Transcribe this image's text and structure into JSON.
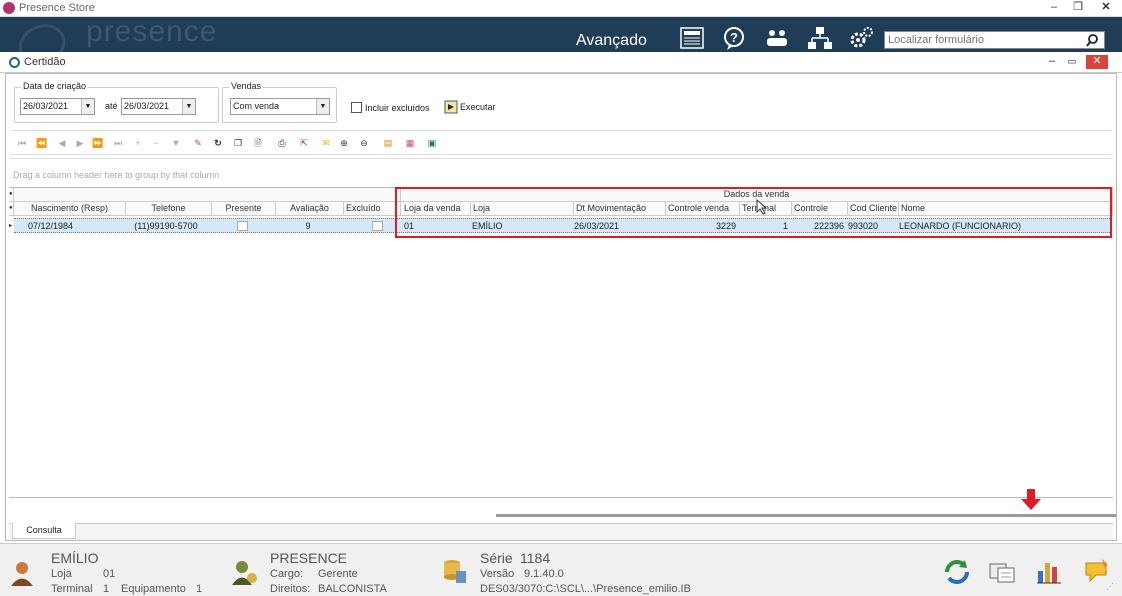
{
  "app": {
    "title": "Presence Store",
    "brand": "presence"
  },
  "banner": {
    "mode_label": "Avançado",
    "search_placeholder": "Localizar formulário"
  },
  "window": {
    "title": "Certidão"
  },
  "filters": {
    "date_group_label": "Data de criação",
    "date_from": "26/03/2021",
    "date_sep": "até",
    "date_to": "26/03/2021",
    "vendas_label": "Vendas",
    "vendas_value": "Com venda",
    "include_deleted_label": "Incluir excluídos",
    "execute_label": "Executar"
  },
  "grid": {
    "group_hint": "Drag a column header here to group by that column",
    "band_label": "Dados da venda",
    "columns": [
      "Nascimento (Resp)",
      "Telefone",
      "Presente",
      "Avaliação",
      "Excluído",
      "Loja da venda",
      "Loja",
      "Dt Movimentação",
      "Controle venda",
      "Terminal",
      "Controle item",
      "Cod Cliente",
      "Nome"
    ],
    "row": {
      "nascimento": "07/12/1984",
      "telefone": "(11)99190-5700",
      "avaliacao": "9",
      "loja_venda": "01",
      "loja": "EMÍLIO",
      "dt_mov": "26/03/2021",
      "controle_venda": "3229",
      "terminal": "1",
      "controle_item": "222396",
      "cod_cliente": "993020",
      "nome": "LEONARDO (FUNCIONARIO)"
    }
  },
  "tabs": {
    "active": "Consulta"
  },
  "status": {
    "user_name": "EMÍLIO",
    "loja_label": "Loja",
    "loja_value": "01",
    "terminal_label": "Terminal",
    "terminal_value": "1",
    "equip_label": "Equipamento",
    "equip_value": "1",
    "company": "PRESENCE",
    "cargo_label": "Cargo:",
    "cargo_value": "Gerente",
    "direitos_label": "Direitos:",
    "direitos_value": "BALCONISTA",
    "serie_label": "Série",
    "serie_value": "1184",
    "versao_label": "Versão",
    "versao_value": "9.1.40.0",
    "db_path": "DES03/3070:C:\\SCL\\...\\Presence_emilio.IB"
  },
  "colors": {
    "banner": "#1f3d57",
    "highlight": "#e01b24",
    "selection": "#d4e8f8"
  }
}
